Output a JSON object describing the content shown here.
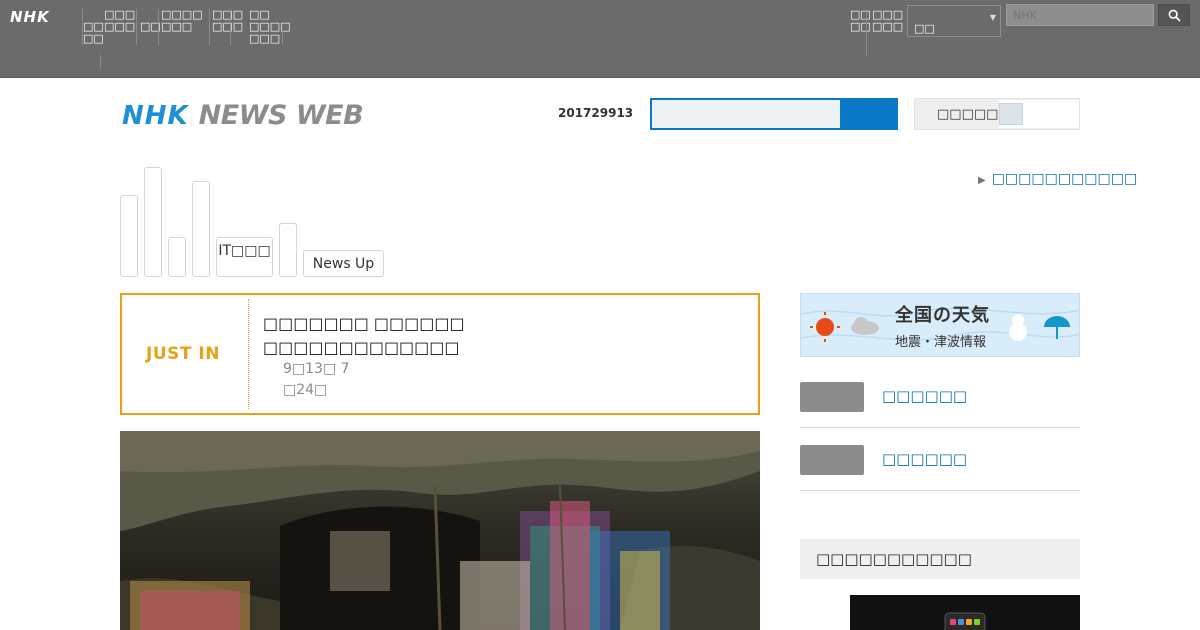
{
  "global_bar": {
    "logo": "NHK",
    "nav_items": [
      "□□\n□□",
      "□□□\n□□□",
      "□□",
      "□□□□\n□□□",
      "□□□\n□□□",
      "□□\n□□□□\n□□□"
    ],
    "right_item_1": "□□\n□□",
    "right_item_2": "□□□\n□□□",
    "select_value": "□□",
    "search_placeholder": "NHK"
  },
  "header": {
    "logo_nhk": "NHK",
    "logo_newsweb": "NEWS WEB",
    "date": "201729913",
    "toggle_label": "□□□□□"
  },
  "category_tabs": {
    "it_label": "IT□□□",
    "newsup_label": "News Up"
  },
  "promo_link": "□□□□□□□□□□□",
  "just_in": {
    "label": "JUST IN",
    "title": "□□□□□□□ □□□□□□\n□□□□□□□□□□□□□",
    "time": "9□13□ 7\n□24□"
  },
  "sidebar": {
    "weather_title": "全国の天気",
    "weather_sub": "地震・津波情報",
    "links": [
      {
        "label": "□□□□□□"
      },
      {
        "label": "□□□□□□"
      }
    ],
    "section_title": "□□□□□□□□□□□"
  },
  "colors": {
    "brand_blue": "#0b78c5",
    "just_in_orange": "#e6a117",
    "top_bar_gray": "#6b6b6b",
    "link_blue": "#0b6fae"
  }
}
